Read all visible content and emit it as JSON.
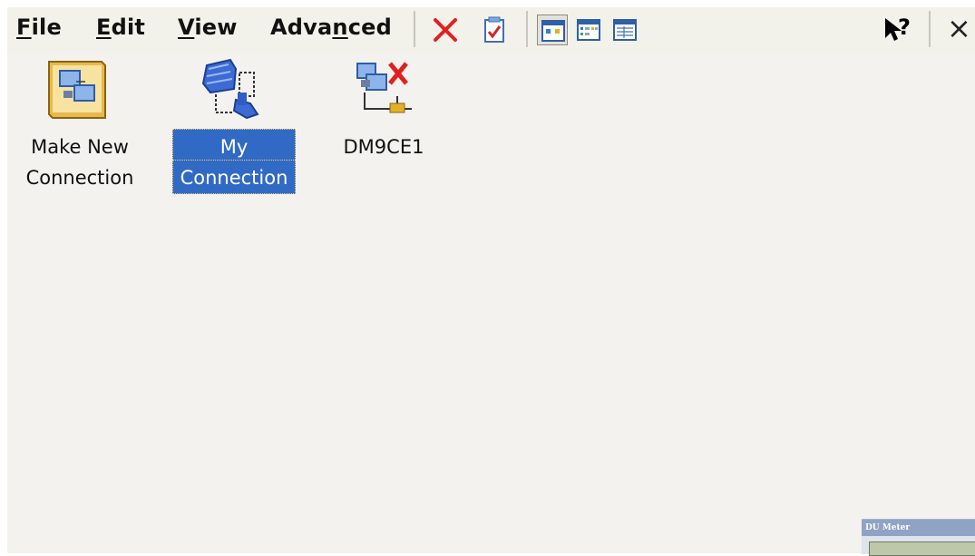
{
  "menu": {
    "file": {
      "pre": "",
      "hot": "F",
      "post": "ile"
    },
    "edit": {
      "pre": "",
      "hot": "E",
      "post": "dit"
    },
    "view": {
      "pre": "",
      "hot": "V",
      "post": "iew"
    },
    "advanced": {
      "pre": "Adva",
      "hot": "n",
      "post": "ced"
    }
  },
  "toolbar": {
    "delete_icon": "red-x-icon",
    "properties_icon": "properties-icon",
    "view_modes": [
      "large-icons-view",
      "small-icons-view",
      "details-view"
    ],
    "selected_view": "large-icons-view",
    "help_glyph": "?",
    "close_glyph": "×"
  },
  "items": [
    {
      "line1": "Make New",
      "line2": "Connection",
      "icon": "new-connection-wizard-icon",
      "selected": false
    },
    {
      "line1": "My",
      "line2": "Connection",
      "icon": "dialup-connection-icon",
      "selected": true
    },
    {
      "line1": "DM9CE1",
      "line2": "",
      "icon": "disconnected-network-icon",
      "selected": false
    }
  ],
  "colors": {
    "selection": "#316ac5",
    "close_x": "#e02020",
    "content_bg": "#f3f2ee"
  }
}
